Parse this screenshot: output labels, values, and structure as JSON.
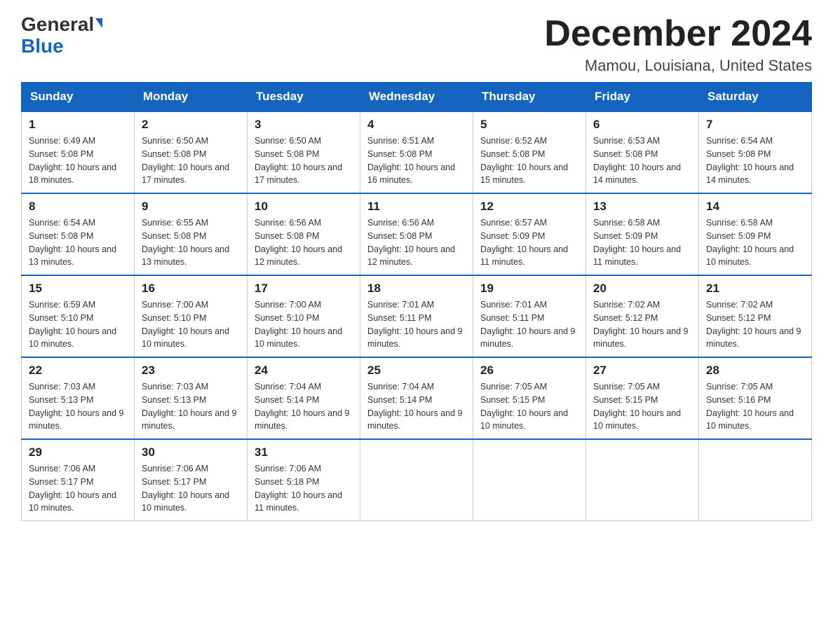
{
  "logo": {
    "general": "General",
    "blue": "Blue"
  },
  "title": "December 2024",
  "location": "Mamou, Louisiana, United States",
  "days_of_week": [
    "Sunday",
    "Monday",
    "Tuesday",
    "Wednesday",
    "Thursday",
    "Friday",
    "Saturday"
  ],
  "weeks": [
    [
      {
        "day": "1",
        "sunrise": "6:49 AM",
        "sunset": "5:08 PM",
        "daylight": "10 hours and 18 minutes."
      },
      {
        "day": "2",
        "sunrise": "6:50 AM",
        "sunset": "5:08 PM",
        "daylight": "10 hours and 17 minutes."
      },
      {
        "day": "3",
        "sunrise": "6:50 AM",
        "sunset": "5:08 PM",
        "daylight": "10 hours and 17 minutes."
      },
      {
        "day": "4",
        "sunrise": "6:51 AM",
        "sunset": "5:08 PM",
        "daylight": "10 hours and 16 minutes."
      },
      {
        "day": "5",
        "sunrise": "6:52 AM",
        "sunset": "5:08 PM",
        "daylight": "10 hours and 15 minutes."
      },
      {
        "day": "6",
        "sunrise": "6:53 AM",
        "sunset": "5:08 PM",
        "daylight": "10 hours and 14 minutes."
      },
      {
        "day": "7",
        "sunrise": "6:54 AM",
        "sunset": "5:08 PM",
        "daylight": "10 hours and 14 minutes."
      }
    ],
    [
      {
        "day": "8",
        "sunrise": "6:54 AM",
        "sunset": "5:08 PM",
        "daylight": "10 hours and 13 minutes."
      },
      {
        "day": "9",
        "sunrise": "6:55 AM",
        "sunset": "5:08 PM",
        "daylight": "10 hours and 13 minutes."
      },
      {
        "day": "10",
        "sunrise": "6:56 AM",
        "sunset": "5:08 PM",
        "daylight": "10 hours and 12 minutes."
      },
      {
        "day": "11",
        "sunrise": "6:56 AM",
        "sunset": "5:08 PM",
        "daylight": "10 hours and 12 minutes."
      },
      {
        "day": "12",
        "sunrise": "6:57 AM",
        "sunset": "5:09 PM",
        "daylight": "10 hours and 11 minutes."
      },
      {
        "day": "13",
        "sunrise": "6:58 AM",
        "sunset": "5:09 PM",
        "daylight": "10 hours and 11 minutes."
      },
      {
        "day": "14",
        "sunrise": "6:58 AM",
        "sunset": "5:09 PM",
        "daylight": "10 hours and 10 minutes."
      }
    ],
    [
      {
        "day": "15",
        "sunrise": "6:59 AM",
        "sunset": "5:10 PM",
        "daylight": "10 hours and 10 minutes."
      },
      {
        "day": "16",
        "sunrise": "7:00 AM",
        "sunset": "5:10 PM",
        "daylight": "10 hours and 10 minutes."
      },
      {
        "day": "17",
        "sunrise": "7:00 AM",
        "sunset": "5:10 PM",
        "daylight": "10 hours and 10 minutes."
      },
      {
        "day": "18",
        "sunrise": "7:01 AM",
        "sunset": "5:11 PM",
        "daylight": "10 hours and 9 minutes."
      },
      {
        "day": "19",
        "sunrise": "7:01 AM",
        "sunset": "5:11 PM",
        "daylight": "10 hours and 9 minutes."
      },
      {
        "day": "20",
        "sunrise": "7:02 AM",
        "sunset": "5:12 PM",
        "daylight": "10 hours and 9 minutes."
      },
      {
        "day": "21",
        "sunrise": "7:02 AM",
        "sunset": "5:12 PM",
        "daylight": "10 hours and 9 minutes."
      }
    ],
    [
      {
        "day": "22",
        "sunrise": "7:03 AM",
        "sunset": "5:13 PM",
        "daylight": "10 hours and 9 minutes."
      },
      {
        "day": "23",
        "sunrise": "7:03 AM",
        "sunset": "5:13 PM",
        "daylight": "10 hours and 9 minutes."
      },
      {
        "day": "24",
        "sunrise": "7:04 AM",
        "sunset": "5:14 PM",
        "daylight": "10 hours and 9 minutes."
      },
      {
        "day": "25",
        "sunrise": "7:04 AM",
        "sunset": "5:14 PM",
        "daylight": "10 hours and 9 minutes."
      },
      {
        "day": "26",
        "sunrise": "7:05 AM",
        "sunset": "5:15 PM",
        "daylight": "10 hours and 10 minutes."
      },
      {
        "day": "27",
        "sunrise": "7:05 AM",
        "sunset": "5:15 PM",
        "daylight": "10 hours and 10 minutes."
      },
      {
        "day": "28",
        "sunrise": "7:05 AM",
        "sunset": "5:16 PM",
        "daylight": "10 hours and 10 minutes."
      }
    ],
    [
      {
        "day": "29",
        "sunrise": "7:06 AM",
        "sunset": "5:17 PM",
        "daylight": "10 hours and 10 minutes."
      },
      {
        "day": "30",
        "sunrise": "7:06 AM",
        "sunset": "5:17 PM",
        "daylight": "10 hours and 10 minutes."
      },
      {
        "day": "31",
        "sunrise": "7:06 AM",
        "sunset": "5:18 PM",
        "daylight": "10 hours and 11 minutes."
      },
      null,
      null,
      null,
      null
    ]
  ]
}
